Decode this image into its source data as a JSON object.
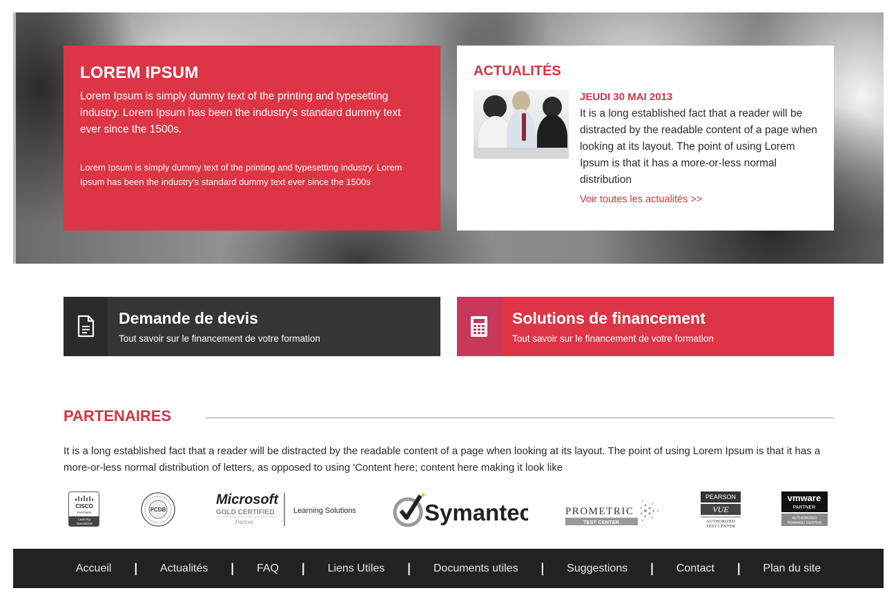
{
  "hero": {
    "promo": {
      "title": "LOREM IPSUM",
      "para1": "Lorem Ipsum is simply dummy text of the printing and typesetting industry. Lorem Ipsum has been the industry's standard dummy text ever since the 1500s.",
      "para2": "Lorem Ipsum is simply dummy text of the printing and typesetting industry. Lorem Ipsum has been the industry's standard dummy text ever since the 1500s"
    },
    "news": {
      "title": "ACTUALITÉS",
      "date": "JEUDI 30 MAI 2013",
      "text": "It is a long established fact that a reader will be distracted by the readable content of a page when looking at its layout. The point of using Lorem Ipsum is that it has a more-or-less normal distribution",
      "link": "Voir toutes les actualités >>"
    }
  },
  "cta": {
    "quote": {
      "title": "Demande de devis",
      "subtitle": "Tout savoir sur le financement de votre formation",
      "icon": "document-icon"
    },
    "financing": {
      "title": "Solutions de financement",
      "subtitle": "Tout savoir sur le financement de votre formation",
      "icon": "calculator-icon"
    }
  },
  "partners": {
    "title": "PARTENAIRES",
    "text": "It is a long established fact that a reader will be distracted by the readable content of a page when looking at its layout. The point of using Lorem Ipsum is that it has a more-or-less normal distribution of letters, as opposed to using 'Content here; content here making it look like",
    "logos": {
      "cisco": {
        "name": "CISCO",
        "line1": "PARTNER",
        "line2": "Learning",
        "line3": "Specialized"
      },
      "pcdb": {
        "name": "PCDB"
      },
      "microsoft": {
        "name": "Microsoft",
        "certified": "GOLD CERTIFIED",
        "partner": "Partner",
        "solutions": "Learning Solutions"
      },
      "symantec": {
        "name": "Symantec"
      },
      "prometric": {
        "name": "PROMETRIC",
        "sub": "TEST CENTER"
      },
      "pearson": {
        "name": "PEARSON",
        "mark": "VUE",
        "sub1": "AUTHORIZED",
        "sub2": "TEST CENTER"
      },
      "vmware": {
        "name": "vmware",
        "partner": "PARTNER",
        "sub1": "AUTHORIZED",
        "sub2": "TRAINING CENTER"
      }
    }
  },
  "footer": {
    "links": [
      "Accueil",
      "Actualités",
      "FAQ",
      "Liens Utiles",
      "Documents utiles",
      "Suggestions",
      "Contact",
      "Plan du site"
    ],
    "separator": "|"
  },
  "colors": {
    "accent": "#dc3545",
    "dark": "#353535",
    "footer": "#222222"
  }
}
